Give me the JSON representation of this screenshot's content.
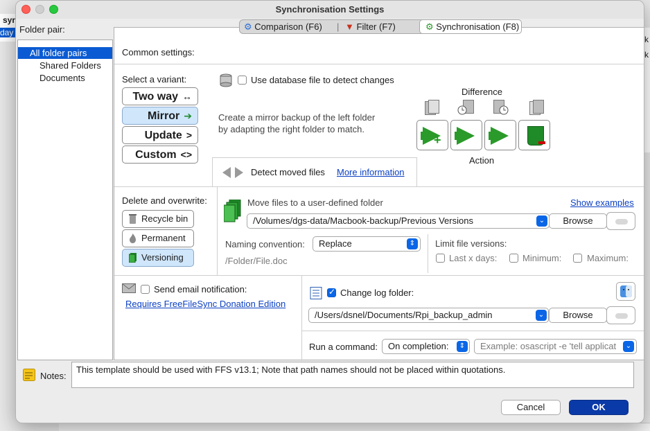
{
  "background": {
    "left_fragments": [
      "syn",
      "day"
    ],
    "right_fragments": [
      "k",
      "k"
    ]
  },
  "window": {
    "title": "Synchronisation Settings"
  },
  "folder_pair": {
    "label": "Folder pair:",
    "items": [
      "All folder pairs",
      "Shared Folders",
      "Documents"
    ]
  },
  "tabs": [
    {
      "label": "Comparison (F6)",
      "icon": "gear-icon"
    },
    {
      "label": "Filter (F7)",
      "icon": "filter-icon"
    },
    {
      "label": "Synchronisation (F8)",
      "icon": "gear-icon",
      "active": true
    }
  ],
  "common_settings": "Common settings:",
  "variant": {
    "label": "Select a variant:",
    "options": [
      {
        "label": "Two way",
        "arrow": "↔"
      },
      {
        "label": "Mirror",
        "arrow": "➔",
        "selected": true
      },
      {
        "label": "Update",
        "arrow": ">"
      },
      {
        "label": "Custom",
        "arrow": "<>"
      }
    ]
  },
  "database": {
    "label": "Use database file to detect changes",
    "checked": false
  },
  "description": [
    "Create a mirror backup of the left folder",
    "by adapting the right folder to match."
  ],
  "difference_label": "Difference",
  "action_label": "Action",
  "detect_moved": {
    "label": "Detect moved files",
    "link": "More information"
  },
  "delete": {
    "label": "Delete and overwrite:",
    "options": [
      "Recycle bin",
      "Permanent",
      "Versioning"
    ],
    "selected": "Versioning"
  },
  "versioning": {
    "move_label": "Move files to a user-defined folder",
    "show_examples": "Show examples",
    "path": "/Volumes/dgs-data/Macbook-backup/Previous Versions",
    "browse": "Browse",
    "naming_label": "Naming convention:",
    "naming_value": "Replace",
    "example_path": "/Folder/File.doc",
    "limit_label": "Limit file versions:",
    "last_x_days": "Last x days:",
    "minimum": "Minimum:",
    "maximum": "Maximum:"
  },
  "email": {
    "label": "Send email notification:",
    "link": "Requires FreeFileSync Donation Edition",
    "checked": false
  },
  "log": {
    "label": "Change log folder:",
    "checked": true,
    "path": "/Users/dsnel/Documents/Rpi_backup_admin",
    "browse": "Browse"
  },
  "command": {
    "label": "Run a command:",
    "when": "On completion:",
    "placeholder": "Example: osascript -e 'tell applicat"
  },
  "notes": {
    "label": "Notes:",
    "text": "This template should be used with FFS v13.1; Note that path names should not be placed within quotations."
  },
  "buttons": {
    "cancel": "Cancel",
    "ok": "OK"
  },
  "colors": {
    "accent": "#0a66e6",
    "selected_bg": "#cfe6fb",
    "ok_bg": "#0a3aa8",
    "sync_green": "#2a9a2a",
    "list_selection": "#0a5bd3"
  }
}
